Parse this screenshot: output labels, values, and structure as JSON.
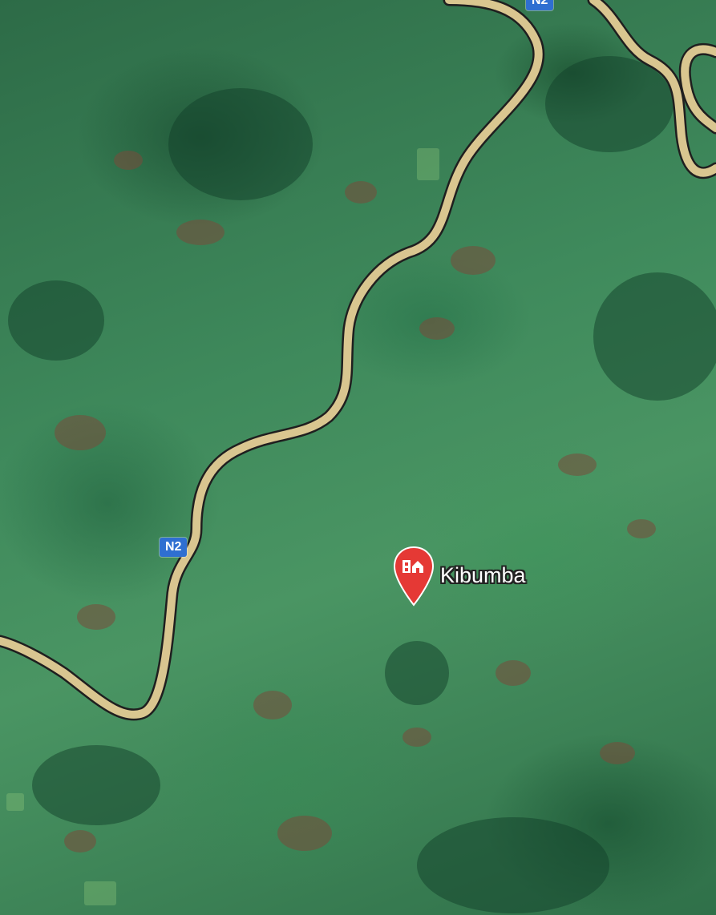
{
  "map": {
    "type": "satellite",
    "place": {
      "name": "Kibumba",
      "icon": "home-pin-icon",
      "pin_color": "#e53935"
    },
    "roads": [
      {
        "ref": "N2",
        "color": "#d9c690"
      }
    ],
    "shields": [
      {
        "label": "N2",
        "color": "#2f6fd1"
      },
      {
        "label": "N2",
        "color": "#2f6fd1"
      }
    ]
  }
}
